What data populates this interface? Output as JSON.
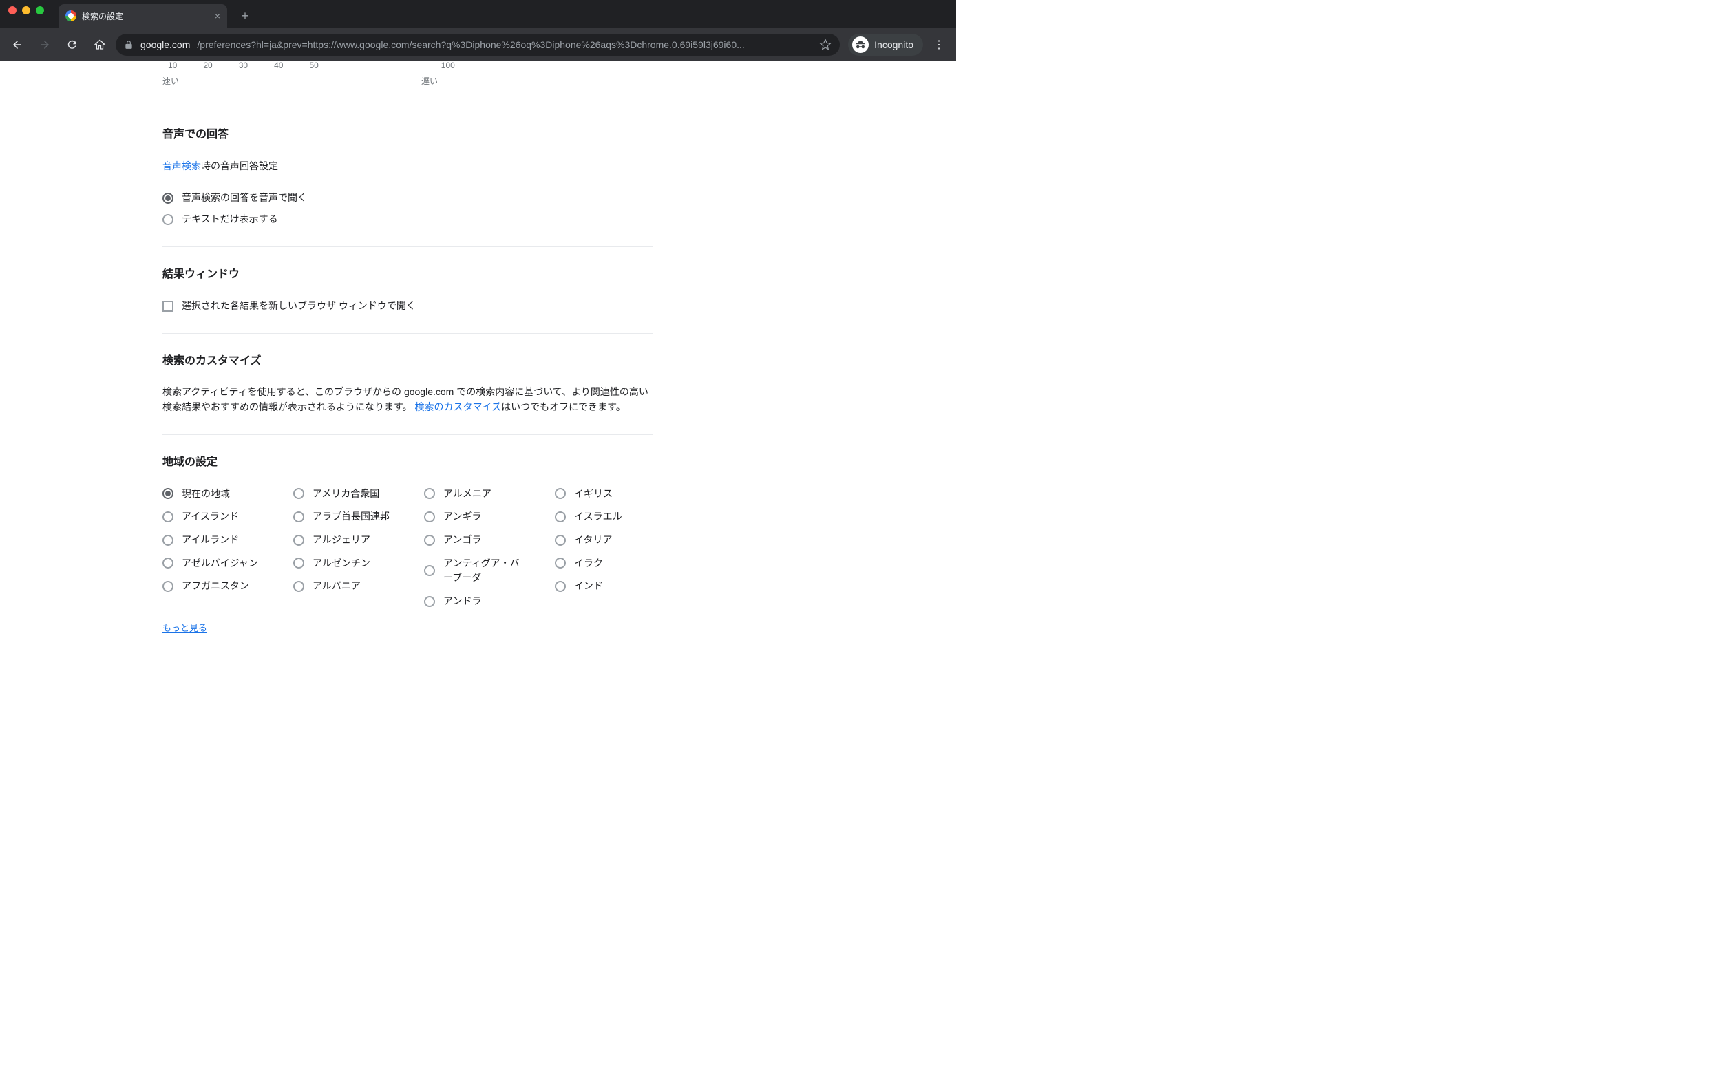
{
  "browser": {
    "tab_title": "検索の設定",
    "url_host": "google.com",
    "url_path": "/preferences?hl=ja&prev=https://www.google.com/search?q%3Diphone%26oq%3Diphone%26aqs%3Dchrome.0.69i59l3j69i60...",
    "incognito_label": "Incognito"
  },
  "slider": {
    "ticks": [
      "10",
      "20",
      "30",
      "40",
      "50",
      "100"
    ],
    "fast_label": "速い",
    "slow_label": "遅い"
  },
  "voice": {
    "heading": "音声での回答",
    "link_text": "音声検索",
    "desc_suffix": "時の音声回答設定",
    "opt_speak": "音声検索の回答を音声で聞く",
    "opt_text": "テキストだけ表示する"
  },
  "results_window": {
    "heading": "結果ウィンドウ",
    "checkbox_label": "選択された各結果を新しいブラウザ ウィンドウで開く"
  },
  "customize": {
    "heading": "検索のカスタマイズ",
    "para_pre": "検索アクティビティを使用すると、このブラウザからの google.com での検索内容に基づいて、より関連性の高い検索結果やおすすめの情報が表示されるようになります。",
    "link_text": "検索のカスタマイズ",
    "para_post": "はいつでもオフにできます。"
  },
  "region": {
    "heading": "地域の設定",
    "more": "もっと見る",
    "cols": [
      [
        "現在の地域",
        "アイスランド",
        "アイルランド",
        "アゼルバイジャン",
        "アフガニスタン"
      ],
      [
        "アメリカ合衆国",
        "アラブ首長国連邦",
        "アルジェリア",
        "アルゼンチン",
        "アルバニア"
      ],
      [
        "アルメニア",
        "アンギラ",
        "アンゴラ",
        "アンティグア・バーブーダ",
        "アンドラ"
      ],
      [
        "イギリス",
        "イスラエル",
        "イタリア",
        "イラク",
        "インド"
      ]
    ],
    "selected": "現在の地域"
  }
}
